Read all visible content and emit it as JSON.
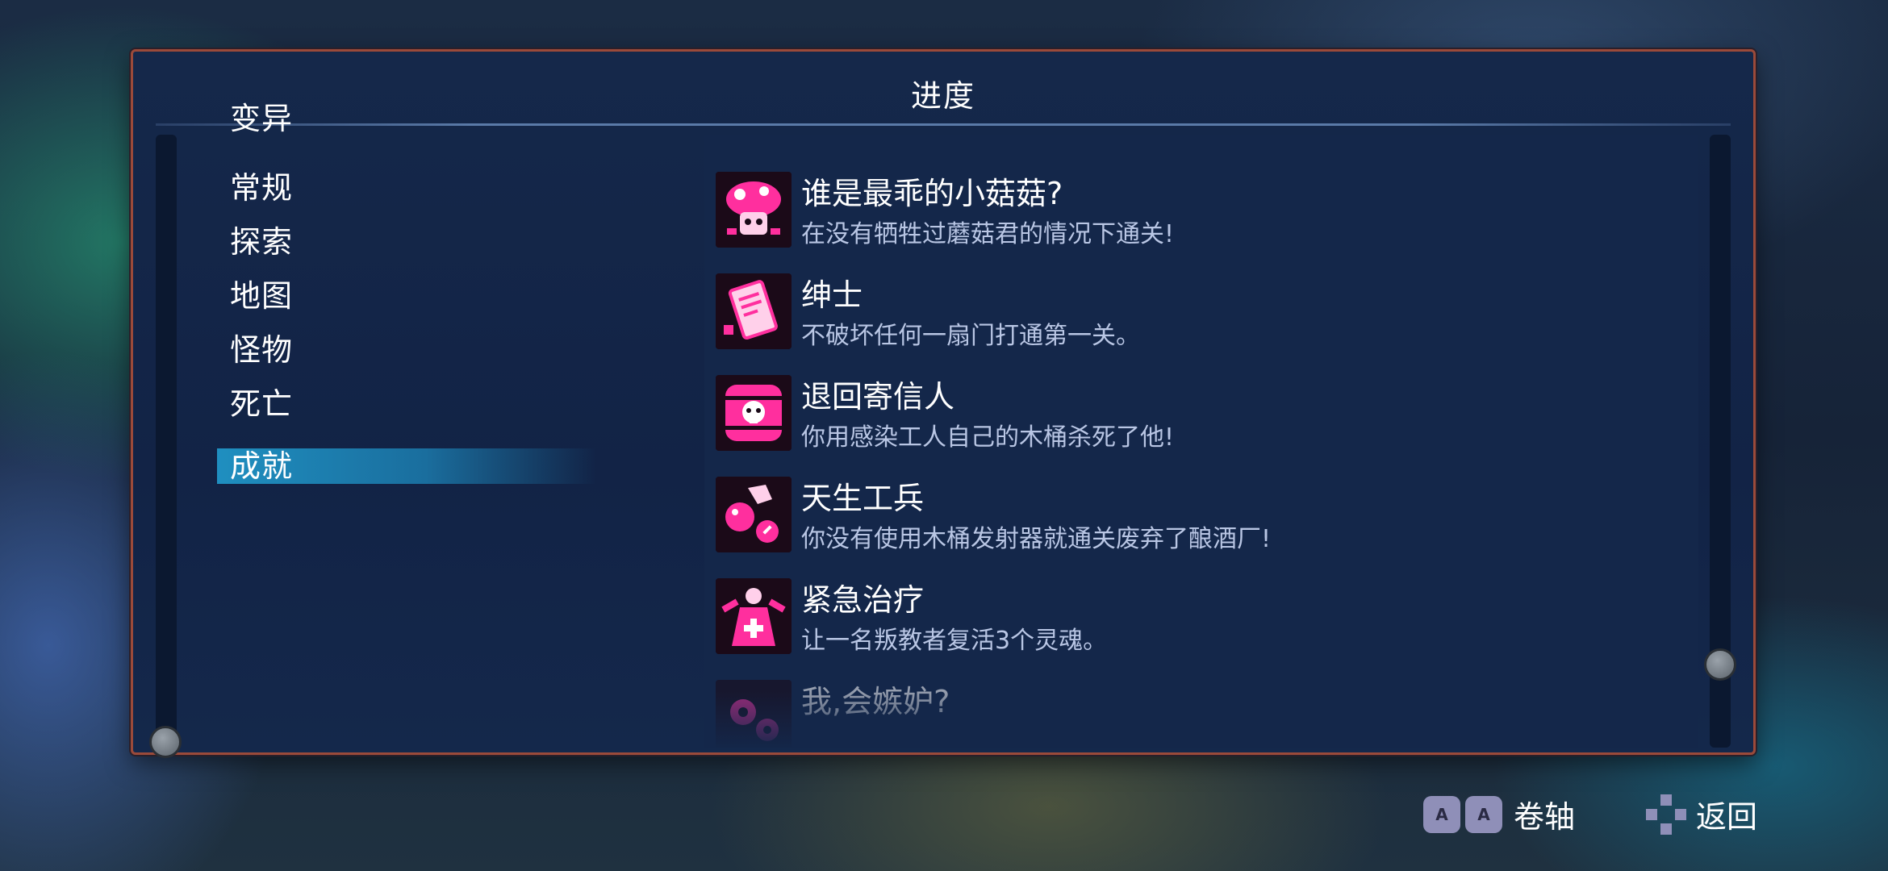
{
  "panel": {
    "title": "进度"
  },
  "categories": [
    {
      "label": "变异",
      "selected": false
    },
    {
      "label": "常规",
      "selected": false
    },
    {
      "label": "探索",
      "selected": false
    },
    {
      "label": "地图",
      "selected": false
    },
    {
      "label": "怪物",
      "selected": false
    },
    {
      "label": "死亡",
      "selected": false
    },
    {
      "label": "成就",
      "selected": true
    }
  ],
  "achievements": [
    {
      "name": "谁是最乖的小菇菇?",
      "desc": "在没有牺牲过蘑菇君的情况下通关!",
      "icon": "mushroom-icon"
    },
    {
      "name": "绅士",
      "desc": "不破坏任何一扇门打通第一关。",
      "icon": "card-icon"
    },
    {
      "name": "退回寄信人",
      "desc": "你用感染工人自己的木桶杀死了他!",
      "icon": "barrel-skull-icon"
    },
    {
      "name": "天生工兵",
      "desc": "你没有使用木桶发射器就通关废弃了酿酒厂!",
      "icon": "explosive-icon"
    },
    {
      "name": "紧急治疗",
      "desc": "让一名叛教者复活3个灵魂。",
      "icon": "healer-icon"
    },
    {
      "name": "我,会嫉妒?",
      "desc": "",
      "icon": "gear-icon"
    }
  ],
  "prompts": {
    "scroll_label": "卷轴",
    "back_label": "返回"
  },
  "colors": {
    "accent_pink": "#ff2f9e",
    "selected_bar": "#1f8fc0",
    "panel_border": "#9b4a3a"
  }
}
